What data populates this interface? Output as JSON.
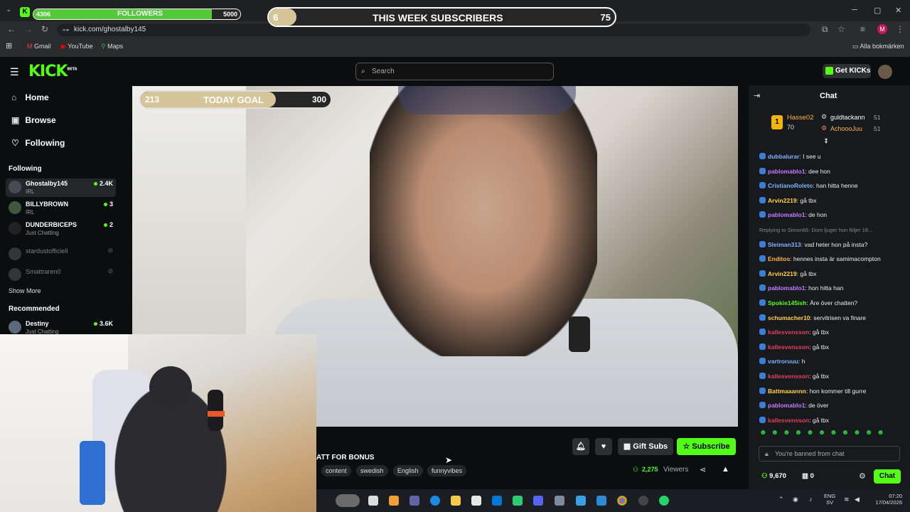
{
  "browser": {
    "url": "kick.com/ghostalby145",
    "bookmarks": [
      "Gmail",
      "YouTube",
      "Maps"
    ],
    "all_bookmarks": "Alla bokmärken",
    "profile_initial": "M"
  },
  "overlays": {
    "followers": {
      "current": "4306",
      "label": "FOLLOWERS",
      "goal": "5000",
      "progress": 0.861
    },
    "subscribers": {
      "current": "6",
      "label": "THIS WEEK SUBSCRIBERS",
      "goal": "75",
      "progress": 0.08
    },
    "today_goal": {
      "current": "213",
      "label": "TODAY GOAL",
      "goal": "300",
      "progress": 0.71
    }
  },
  "header": {
    "logo": "KICK",
    "logo_badge": "BETA",
    "search_placeholder": "Search",
    "get_kicks": "Get KICKs"
  },
  "sidebar": {
    "nav": [
      {
        "label": "Home",
        "icon": "home-icon"
      },
      {
        "label": "Browse",
        "icon": "browse-icon"
      },
      {
        "label": "Following",
        "icon": "heart-icon"
      }
    ],
    "following_title": "Following",
    "following": [
      {
        "name": "Ghostalby145",
        "category": "IRL",
        "viewers": "2.4K",
        "live": true
      },
      {
        "name": "BILLYBROWN",
        "category": "IRL",
        "viewers": "3",
        "live": true
      },
      {
        "name": "DUNDERBICEPS",
        "category": "Just Chatting",
        "viewers": "2",
        "live": true
      },
      {
        "name": "stardustofficiell",
        "category": "",
        "viewers": "",
        "live": false
      },
      {
        "name": "Smattraren0",
        "category": "",
        "viewers": "",
        "live": false
      }
    ],
    "show_more": "Show More",
    "recommended_title": "Recommended",
    "recommended": [
      {
        "name": "Destiny",
        "category": "Just Chatting",
        "viewers": "3.6K"
      }
    ]
  },
  "stream": {
    "title_fragment": "ATT FOR BONUS",
    "tags": [
      "content",
      "swedish",
      "English",
      "funnyvibes"
    ],
    "viewers_label": "Viewers",
    "viewers_count": "2,275",
    "gift_subs": "Gift Subs",
    "subscribe": "Subscribe"
  },
  "chat": {
    "title": "Chat",
    "top_gifters": [
      {
        "name": "Hasse02",
        "count": "70"
      },
      {
        "name": "guldtackann",
        "count": "51"
      },
      {
        "name": "AchoooJuu",
        "count": "51"
      }
    ],
    "messages": [
      {
        "user": "dubbalurar",
        "text": ": I see u",
        "color": "#7ab4ff"
      },
      {
        "user": "pablomablo1",
        "text": ": dee hon",
        "color": "#c47cff"
      },
      {
        "user": "CristianoRoleto",
        "text": ": han hitta henne",
        "color": "#7ab4ff"
      },
      {
        "user": "Arvin2219",
        "text": ": gå tbx",
        "color": "#ffd23c"
      },
      {
        "user": "pablomablo1",
        "text": ": de hon",
        "color": "#c47cff"
      },
      {
        "user": "",
        "text": "Replying to Simon66: Dom ljuger hon följer 18...",
        "color": "#888"
      },
      {
        "user": "Sleiman313",
        "text": ": vad heter hon på insta?",
        "color": "#7ab4ff"
      },
      {
        "user": "Enditos",
        "text": ": hennes insta är samimacompton",
        "color": "#ffb347"
      },
      {
        "user": "Arvin2219",
        "text": ": gå tbx",
        "color": "#ffd23c"
      },
      {
        "user": "pablomablo1",
        "text": ": hon hitta han",
        "color": "#c47cff"
      },
      {
        "user": "Spokie145ish",
        "text": ": Äre över chatten?",
        "color": "#53fc18"
      },
      {
        "user": "schumacher10",
        "text": ": servitrisen va finare",
        "color": "#ffd23c"
      },
      {
        "user": "kallesvensson",
        "text": ": gå tbx",
        "color": "#e0405a"
      },
      {
        "user": "kallesvensson",
        "text": ": gå tbx",
        "color": "#e0405a"
      },
      {
        "user": "vartroruuu",
        "text": ": h",
        "color": "#7ab4ff"
      },
      {
        "user": "kallesvensson",
        "text": ": gå tbx",
        "color": "#e0405a"
      },
      {
        "user": "Battmaaannn",
        "text": ": hon kommer till gurre",
        "color": "#ffd23c"
      },
      {
        "user": "pablomablo1",
        "text": ": de över",
        "color": "#c47cff"
      },
      {
        "user": "kallesvensson",
        "text": ": gå tbx",
        "color": "#e0405a"
      }
    ],
    "banned_text": "You're banned from chat",
    "kicks_balance": "9,670",
    "points": "0",
    "chat_button": "Chat"
  },
  "taskbar": {
    "language": "ENG",
    "region": "SV",
    "time": "07:20",
    "date": "17/04/2026"
  },
  "colors": {
    "kick_green": "#53fc18"
  }
}
